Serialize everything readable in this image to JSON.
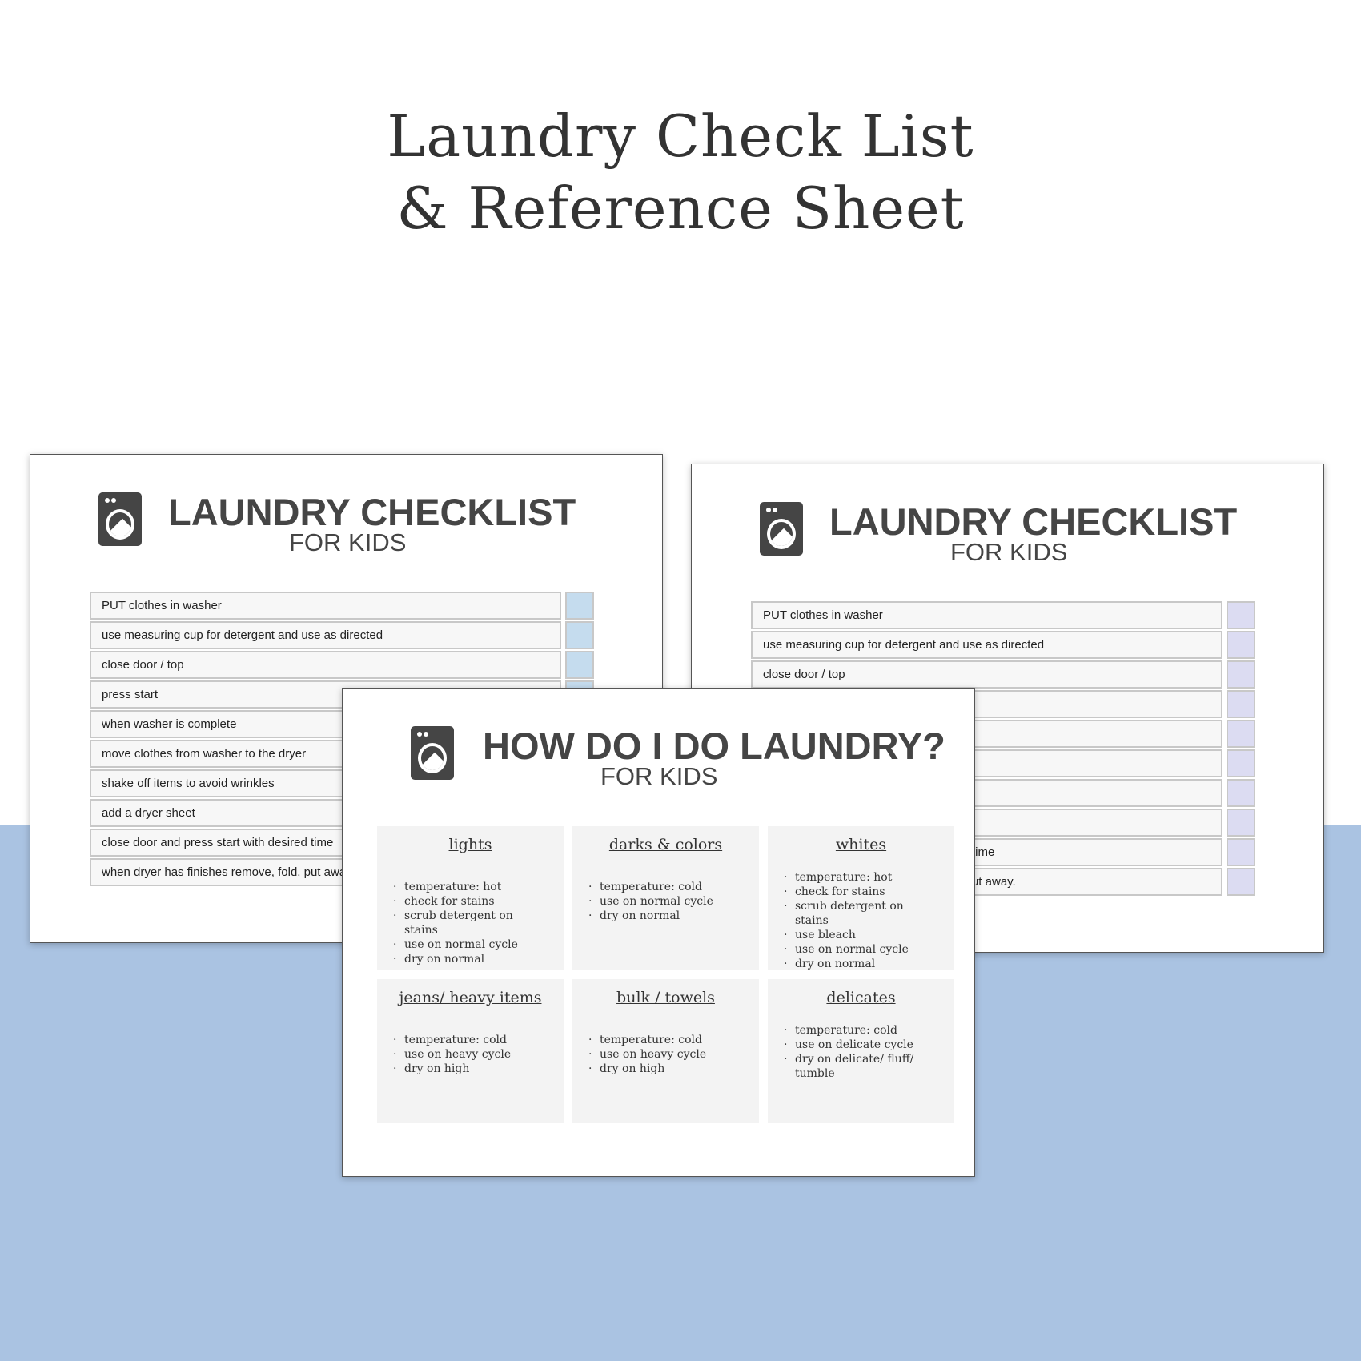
{
  "hero": {
    "line1": "Laundry Check List",
    "line2": "& Reference Sheet"
  },
  "colors": {
    "background_blue": "#aac3e2",
    "checkbox_left": "#c5dcee",
    "checkbox_right": "#dcdcf2",
    "text": "#454545"
  },
  "checklist": {
    "title": "LAUNDRY CHECKLIST",
    "subtitle": "FOR KIDS",
    "icon": "washing-machine-icon",
    "items": [
      "PUT clothes in washer",
      "use measuring cup for detergent and use as directed",
      "close door / top",
      "press start",
      "when washer is complete",
      "move clothes from washer to the dryer",
      "shake off items to avoid wrinkles",
      "add a dryer sheet",
      "close door and press start with desired time",
      "when dryer has finishes remove, fold, put away."
    ]
  },
  "reference": {
    "title": "HOW DO I DO LAUNDRY?",
    "subtitle": "FOR KIDS",
    "icon": "washing-machine-icon",
    "categories": [
      {
        "name": "lights",
        "items": [
          "temperature: hot",
          "check for stains",
          "scrub detergent on stains",
          "use on normal cycle",
          "dry on normal"
        ]
      },
      {
        "name": "darks & colors",
        "items": [
          "temperature: cold",
          "use on normal cycle",
          "dry on normal"
        ]
      },
      {
        "name": "whites",
        "items": [
          "temperature: hot",
          "check for stains",
          "scrub detergent on stains",
          "use bleach",
          "use on normal cycle",
          "dry on normal"
        ]
      },
      {
        "name": "jeans/ heavy items",
        "items": [
          "temperature: cold",
          "use on heavy cycle",
          "dry on high"
        ]
      },
      {
        "name": "bulk / towels",
        "items": [
          "temperature: cold",
          "use on heavy cycle",
          "dry on high"
        ]
      },
      {
        "name": "delicates",
        "items": [
          "temperature: cold",
          "use on delicate cycle",
          "dry on delicate/ fluff/ tumble"
        ]
      }
    ]
  }
}
